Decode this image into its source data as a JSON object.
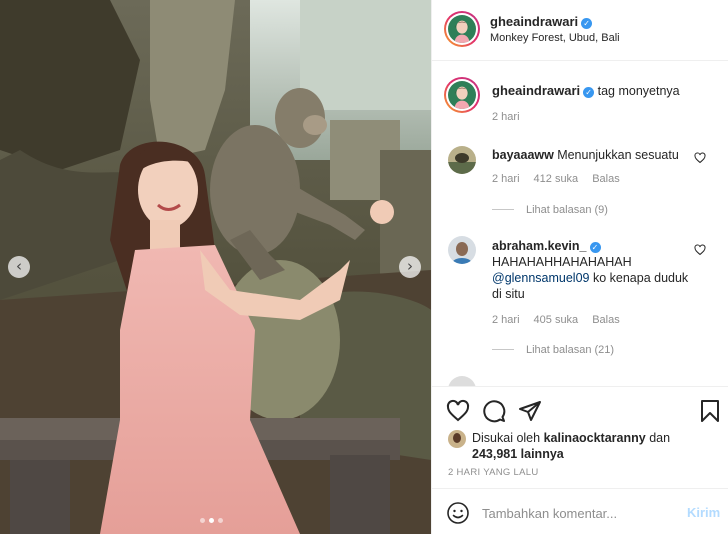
{
  "post": {
    "username": "gheaindrawari",
    "location": "Monkey Forest, Ubud, Bali",
    "caption": "tag monyetnya",
    "caption_time": "2 hari"
  },
  "comments": [
    {
      "username": "bayaaaww",
      "text": "Menunjukkan sesuatu",
      "time": "2 hari",
      "likes": "412 suka",
      "reply": "Balas",
      "view_replies": "Lihat balasan (9)"
    },
    {
      "username": "abraham.kevin_",
      "verified": true,
      "text_line1": "HAHAHAHHAHAHAHAH",
      "mention": "@glennsamuel09",
      "text_rest": " ko kenapa duduk di situ",
      "time": "2 hari",
      "likes": "405 suka",
      "reply": "Balas",
      "view_replies": "Lihat balasan (21)"
    }
  ],
  "likes": {
    "prefix": "Disukai oleh",
    "user": "kalinaocktaranny",
    "and": "dan",
    "count": "243,981 lainnya"
  },
  "post_time": "2 HARI YANG LALU",
  "comment_box": {
    "placeholder": "Tambahkan komentar...",
    "post_label": "Kirim"
  },
  "carousel": {
    "prev": "‹",
    "next": "›",
    "slides": 3,
    "active_slide": 2
  },
  "icons": {
    "like": "heart-icon",
    "comment": "comment-icon",
    "share": "send-icon",
    "save": "bookmark-icon",
    "emoji": "emoji-icon"
  },
  "colors": {
    "verified": "#3897f0",
    "mention": "#00376b",
    "muted": "#8e8e8e",
    "post_disabled": "#b3dbff"
  }
}
